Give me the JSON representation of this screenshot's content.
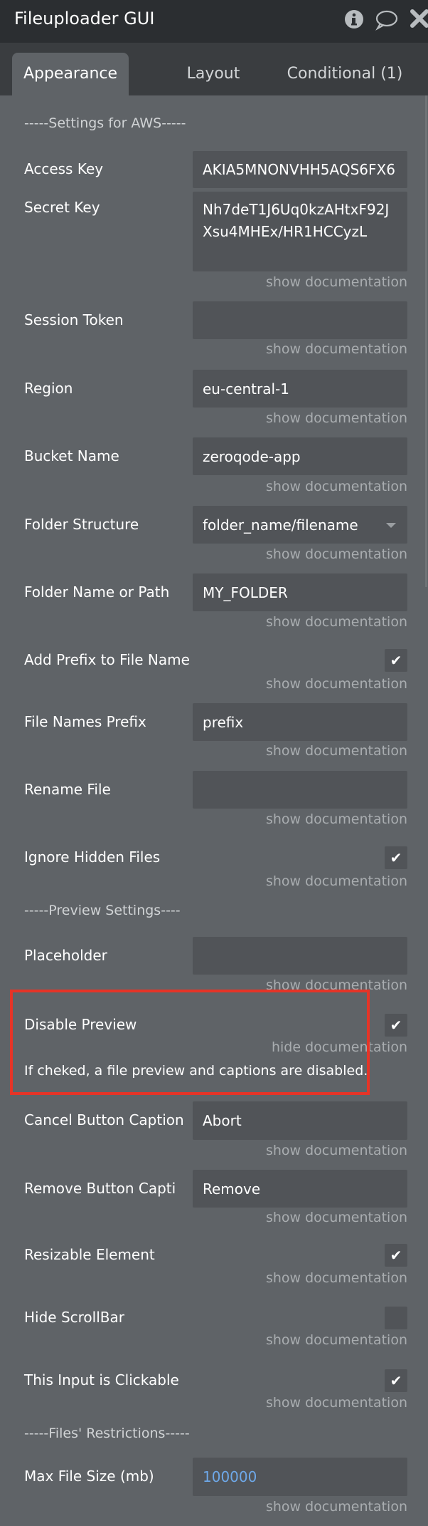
{
  "header": {
    "title": "Fileuploader GUI",
    "icons": [
      "info-icon",
      "comment-icon",
      "close-icon"
    ]
  },
  "tabs": [
    {
      "label": "Appearance",
      "active": true
    },
    {
      "label": "Layout"
    },
    {
      "label": "Conditional (1)"
    }
  ],
  "items": [
    {
      "type": "heading",
      "label": "-----Settings for AWS-----"
    },
    {
      "type": "text",
      "label": "Access Key",
      "value": "AKIA5MNONVHH5AQS6FX6",
      "doc": "show documentation"
    },
    {
      "type": "multi",
      "label": "Secret Key",
      "value": "Nh7deT1J6Uq0kzAHtxF92JXsu4MHEx/HR1HCCyzL",
      "doc": "show documentation"
    },
    {
      "type": "text",
      "label": "Session Token",
      "value": "",
      "doc": "show documentation"
    },
    {
      "type": "text",
      "label": "Region",
      "value": "eu-central-1",
      "doc": "show documentation"
    },
    {
      "type": "text",
      "label": "Bucket Name",
      "value": "zeroqode-app",
      "doc": "show documentation"
    },
    {
      "type": "select",
      "label": "Folder Structure",
      "value": "folder_name/filename",
      "doc": "show documentation"
    },
    {
      "type": "text",
      "label": "Folder Name or Path",
      "value": "MY_FOLDER",
      "doc": "show documentation"
    },
    {
      "type": "checkbox",
      "label": "Add Prefix to File Name",
      "checked": true,
      "doc": "show documentation"
    },
    {
      "type": "text",
      "label": "File Names Prefix",
      "value": "prefix",
      "doc": "show documentation"
    },
    {
      "type": "text",
      "label": "Rename File",
      "value": "",
      "doc": "show documentation"
    },
    {
      "type": "checkbox",
      "label": "Ignore Hidden Files",
      "checked": true,
      "doc": "show documentation"
    },
    {
      "type": "heading",
      "label": "-----Preview Settings----"
    },
    {
      "type": "text",
      "label": "Placeholder",
      "value": "",
      "doc": "show documentation"
    },
    {
      "type": "checkbox",
      "label": "Disable Preview",
      "checked": true,
      "doc": "hide documentation",
      "description": "If cheked, a file preview and captions are disabled.",
      "highlighted": true
    },
    {
      "type": "text",
      "label": "Cancel Button Caption",
      "value": "Abort",
      "doc": "show documentation"
    },
    {
      "type": "text",
      "label": "Remove Button Capti",
      "value": "Remove",
      "doc": "show documentation"
    },
    {
      "type": "checkbox",
      "label": "Resizable Element",
      "checked": true,
      "doc": "show documentation"
    },
    {
      "type": "checkbox",
      "label": "Hide ScrollBar",
      "checked": false,
      "doc": "show documentation"
    },
    {
      "type": "checkbox",
      "label": "This Input is Clickable",
      "checked": true,
      "doc": "show documentation"
    },
    {
      "type": "heading",
      "label": "-----Files' Restrictions-----"
    },
    {
      "type": "text",
      "label": "Max File Size (mb)",
      "value": "100000",
      "value_color": "#6ea8e8",
      "doc": "show documentation"
    }
  ],
  "colors": {
    "highlight": "#e53427",
    "header_bg": "#2b2e31",
    "panel_bg": "#5f6367"
  }
}
